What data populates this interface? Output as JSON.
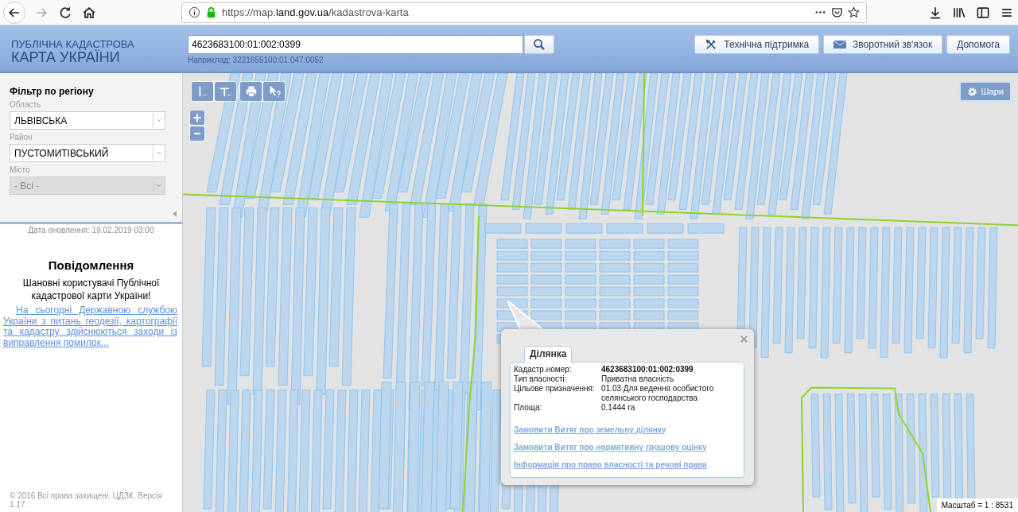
{
  "browser": {
    "url": "https://map.**land.gov.ua**/kadastrova-karta"
  },
  "header": {
    "logo_line1": "ПУБЛІЧНА КАДАСТРОВА",
    "logo_line2": "КАРТА УКРАЇНИ",
    "search": {
      "value": "4623683100:01:002:0399",
      "hint": "Наприклад: 3221655100:01:047:0052"
    },
    "buttons": [
      {
        "label": "Технічна підтримка"
      },
      {
        "label": "Зворотний зв'язок"
      },
      {
        "label": "Допомога"
      }
    ]
  },
  "sidebar": {
    "title": "Фільтр по регіону",
    "fields": [
      {
        "label": "Область",
        "value": "ЛЬВІВСЬКА",
        "disabled": false
      },
      {
        "label": "Район",
        "value": "ПУСТОМИТІВСЬКИЙ",
        "disabled": false
      },
      {
        "label": "Місто",
        "value": "- Всі -",
        "disabled": true
      }
    ],
    "update_date": "Дата оновлення: 19.02.2019 03:00",
    "notice": {
      "title": "Повідомлення",
      "greeting": "Шановні користувачі Публічної кадастрової карти України!",
      "link": "На сьогодні Державною службою України з питань геодезії, картографії та кадастру здійснюються заходи із виправлення помилок..."
    },
    "footer": "© 2016 Всі права захищені. ЦДЗК. Версія 1.17."
  },
  "map": {
    "layers_button": "Шари",
    "scale": "Масштаб = 1 : 8531",
    "popup": {
      "tab": "Ділянка",
      "rows": [
        {
          "label": "Кадастр.номер:",
          "value": "4623683100:01:002:0399",
          "bold": true
        },
        {
          "label": "Тип власності:",
          "value": "Приватна власність",
          "bold": false
        },
        {
          "label": "Цільове призначення:",
          "value": "01.03 Для ведення особистого селянського господарства",
          "bold": false
        },
        {
          "label": "Площа:",
          "value": "0.1444 га",
          "bold": false
        }
      ],
      "links": [
        "Замовити Витяг про земельну ділянку",
        "Замовити Витяг про нормативну грошову оцінку",
        "Інформація про право власності та речові права"
      ]
    }
  }
}
